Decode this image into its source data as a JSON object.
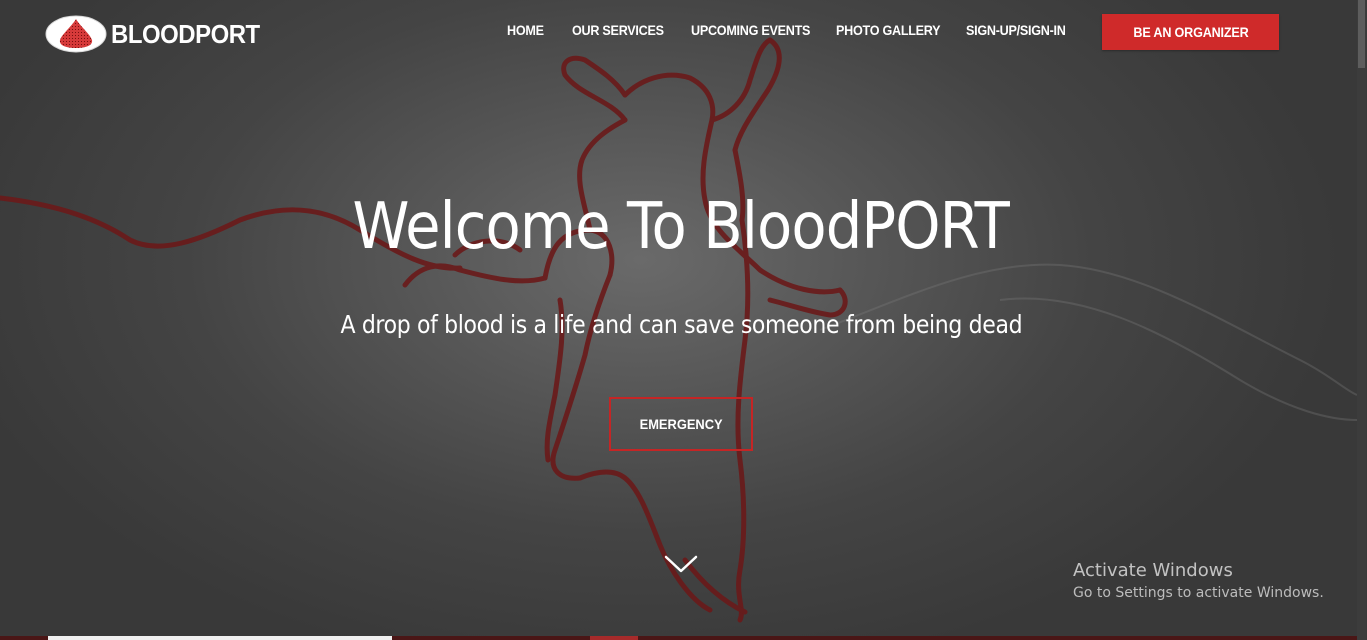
{
  "brand": {
    "name": "BLOODPORT"
  },
  "nav": {
    "items": [
      {
        "label": "HOME"
      },
      {
        "label": "OUR SERVICES"
      },
      {
        "label": "UPCOMING EVENTS"
      },
      {
        "label": "PHOTO GALLERY"
      },
      {
        "label": "SIGN-UP/SIGN-IN"
      }
    ],
    "cta_label": "BE AN ORGANIZER"
  },
  "hero": {
    "title": "Welcome To BloodPORT",
    "subtitle": "A drop of blood is a life and can save someone from being dead",
    "button_label": "EMERGENCY",
    "scroll_icon": "chevron-down-icon"
  },
  "watermark": {
    "line1": "Activate Windows",
    "line2": "Go to Settings to activate Windows."
  },
  "colors": {
    "accent": "#cf2a2a",
    "background": "#4a4a4a",
    "text": "#ffffff"
  }
}
